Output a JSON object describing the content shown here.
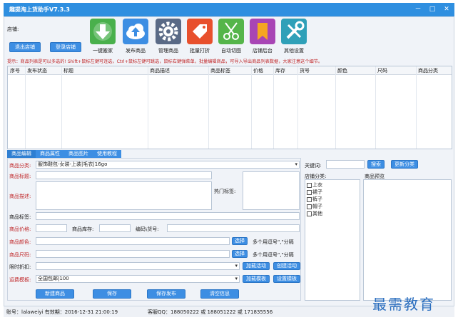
{
  "window": {
    "title": "趣提淘上货助手V7.3.3",
    "minimize": "－",
    "maximize": "□",
    "close": "✕",
    "accent": "#2f8fe0"
  },
  "shop": {
    "label": "店铺:",
    "logout_button": "退出店铺",
    "login_button": "登录店铺"
  },
  "toolbar": [
    {
      "label": "一键搬家",
      "icon": "download-arrow-icon",
      "color": "#49b04c"
    },
    {
      "label": "发布商品",
      "icon": "cloud-upload-icon",
      "color": "#3d8ee3"
    },
    {
      "label": "管理商品",
      "icon": "gear-icon",
      "color": "#5a6a86"
    },
    {
      "label": "批量打折",
      "icon": "price-tag-icon",
      "color": "#e8502d"
    },
    {
      "label": "自动切图",
      "icon": "scissors-icon",
      "color": "#55b54a"
    },
    {
      "label": "店铺后台",
      "icon": "bookmark-icon",
      "color": "#a845b5"
    },
    {
      "label": "其他设置",
      "icon": "tools-icon",
      "color": "#2fa0b8"
    }
  ],
  "hint": "提示：商品列表是可以多选的! Shift+鼠标左键可连选，Ctrl+鼠标左键可跳选，鼠标右键弹菜单，批量编辑商品，可导入导出商品列表数据，大家注意这个细节。",
  "grid_columns": [
    "序号",
    "发布状态",
    "标题",
    "商品描述",
    "商品标签",
    "价格",
    "库存",
    "货号",
    "颜色",
    "尺码",
    "商品分类"
  ],
  "tabs": [
    "商品编辑",
    "商品属性",
    "商品图片",
    "使用教程"
  ],
  "form": {
    "category_label": "商品分类:",
    "category_value": "服饰鞋包-女装-上装|毛衣|16go",
    "title_label": "商品标题:",
    "title_value": "",
    "desc_label": "商品描述:",
    "hot_tags_label": "热门标签:",
    "tags_label": "商品标签:",
    "price_label": "商品价格:",
    "stock_label": "商品库存:",
    "sku_label": "编码\\货号:",
    "color_label": "商品颜色:",
    "color_hint": "多个用逗号\",\"分隔",
    "size_label": "商品尺码:",
    "size_hint": "多个用逗号\",\"分隔",
    "discount_label": "限时折扣:",
    "shipping_label": "运费模板:",
    "shipping_value": "全国包邮|100",
    "select_button": "选择",
    "add_activity_button": "加载活动",
    "create_activity_button": "创建活动",
    "add_template_button": "加载模板",
    "set_template_button": "设置模板"
  },
  "actions": {
    "new": "新建商品",
    "save": "保存",
    "save_publish": "保存发布",
    "clear": "清空信息"
  },
  "right_panel": {
    "keyword_label": "关键词:",
    "search_button": "搜索",
    "update_category_button": "更新分类",
    "shop_category_label": "店铺分类:",
    "preview_label": "商品预览",
    "categories": [
      "上衣",
      "裙子",
      "裤子",
      "帽子",
      "其他"
    ]
  },
  "status": {
    "account": "账号：lalaweiyi 有效期：2016-12-31 21:00:19",
    "service": "客服QQ：188050222 或 188051222 或 171835556"
  },
  "watermark": "最需教育"
}
